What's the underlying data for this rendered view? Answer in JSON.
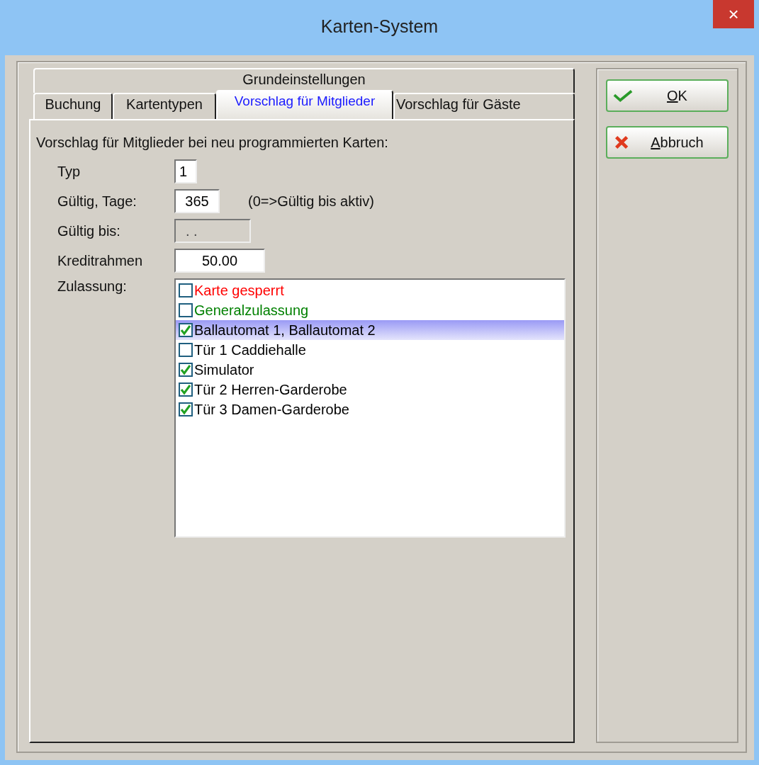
{
  "window": {
    "title": "Karten-System",
    "close": "×"
  },
  "tabs_back": [
    {
      "label": "Grundeinstellungen",
      "selected": false
    }
  ],
  "tabs": [
    {
      "label": "Buchung",
      "selected": false
    },
    {
      "label": "Kartentypen",
      "selected": false
    },
    {
      "label": "Vorschlag für Mitglieder",
      "selected": true
    },
    {
      "label": "Vorschlag für Gäste",
      "selected": false
    }
  ],
  "intro": "Vorschlag für Mitglieder bei neu programmierten Karten:",
  "fields": [
    {
      "label": "Typ",
      "value": "1",
      "kind": "small",
      "disabled": false
    },
    {
      "label": "Gültig, Tage:",
      "value": "365",
      "kind": "medium",
      "disabled": false,
      "hint": "(0=>Gültig bis aktiv)"
    },
    {
      "label": "Gültig bis:",
      "value": ". .",
      "kind": "date",
      "disabled": true
    },
    {
      "label": "Kreditrahmen",
      "value": "50.00",
      "kind": "wide",
      "disabled": false
    }
  ],
  "zulassung": {
    "label": "Zulassung:",
    "items": [
      {
        "label": "Karte gesperrt",
        "checked": false,
        "selected": false,
        "color": "#ff0000"
      },
      {
        "label": "Generalzulassung",
        "checked": false,
        "selected": false,
        "color": "#008000"
      },
      {
        "label": "Ballautomat 1, Ballautomat 2",
        "checked": true,
        "selected": true,
        "color": "#000000"
      },
      {
        "label": "Tür 1 Caddiehalle",
        "checked": false,
        "selected": false,
        "color": "#000000"
      },
      {
        "label": "Simulator",
        "checked": true,
        "selected": false,
        "color": "#000000"
      },
      {
        "label": "Tür 2 Herren-Garderobe",
        "checked": true,
        "selected": false,
        "color": "#000000"
      },
      {
        "label": "Tür 3 Damen-Garderobe",
        "checked": true,
        "selected": false,
        "color": "#000000"
      }
    ]
  },
  "buttons": [
    {
      "label": "OK",
      "kind": "ok"
    },
    {
      "label": "Abbruch",
      "kind": "cancel"
    }
  ]
}
